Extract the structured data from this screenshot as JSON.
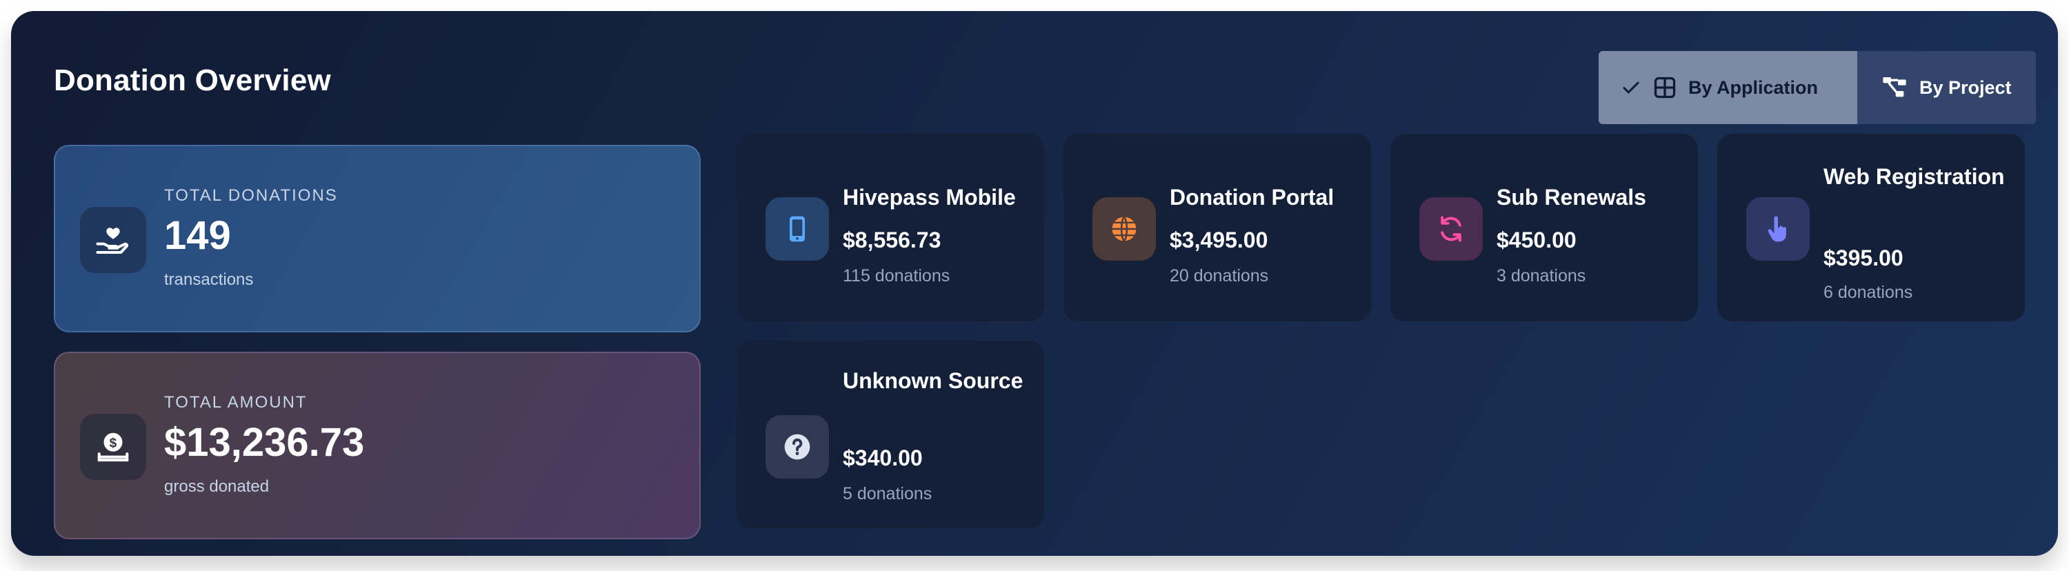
{
  "header": {
    "title": "Donation Overview"
  },
  "view_toggle": {
    "active_label": "By Application",
    "inactive_label": "By Project"
  },
  "summary": {
    "donations": {
      "label": "TOTAL DONATIONS",
      "value": "149",
      "sub": "transactions",
      "icon": "hand-heart-icon"
    },
    "amount": {
      "label": "TOTAL AMOUNT",
      "value": "$13,236.73",
      "sub": "gross donated",
      "icon": "money-hand-icon"
    }
  },
  "sources": [
    {
      "name": "Hivepass Mobile",
      "amount": "$8,556.73",
      "count": "115 donations",
      "icon": "mobile-phone-icon",
      "color": "#5aa9ff"
    },
    {
      "name": "Donation Portal",
      "amount": "$3,495.00",
      "count": "20 donations",
      "icon": "globe-icon",
      "color": "#ff8a3d"
    },
    {
      "name": "Sub Renewals",
      "amount": "$450.00",
      "count": "3 donations",
      "icon": "refresh-icon",
      "color": "#ff4fa3"
    },
    {
      "name": "Web Registration",
      "amount": "$395.00",
      "count": "6 donations",
      "icon": "pointer-hand-icon",
      "color": "#7b84ff"
    },
    {
      "name": "Unknown Source",
      "amount": "$340.00",
      "count": "5 donations",
      "icon": "question-icon",
      "color": "#dfe5f0"
    }
  ]
}
